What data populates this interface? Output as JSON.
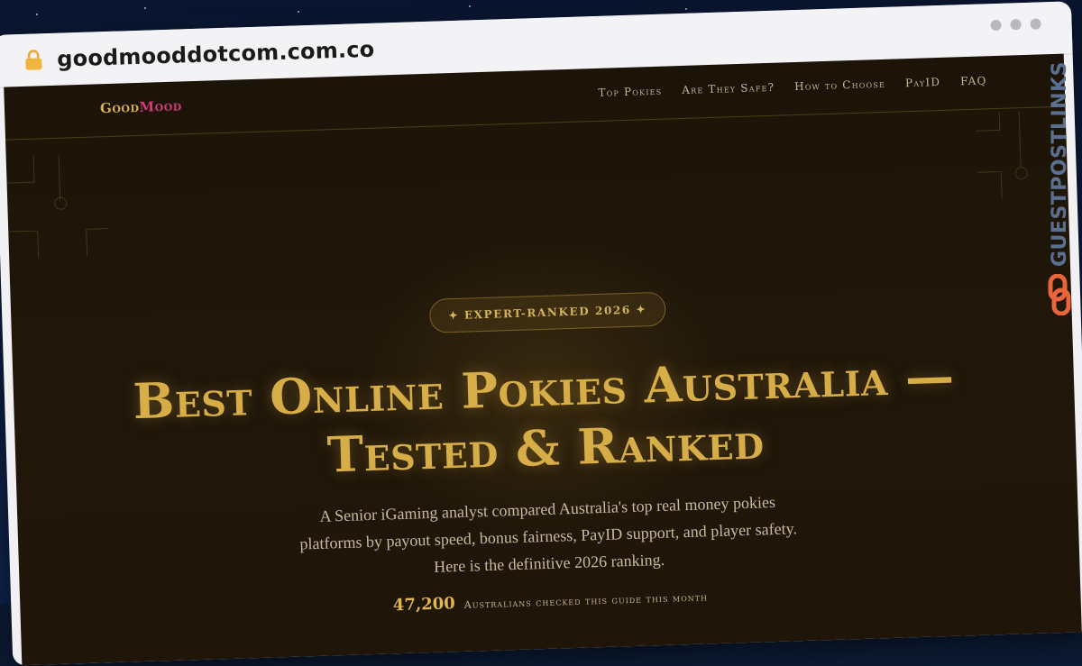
{
  "browser": {
    "url": "goodmooddotcom.com.co"
  },
  "site": {
    "logo_part1": "Good",
    "logo_part2": "Mood",
    "nav": [
      {
        "label": "Top Pokies"
      },
      {
        "label": "Are They Safe?"
      },
      {
        "label": "How to Choose"
      },
      {
        "label": "PayID"
      },
      {
        "label": "FAQ"
      }
    ]
  },
  "hero": {
    "badge": "✦ EXPERT-RANKED 2026 ✦",
    "title": "Best Online Pokies Australia — Tested & Ranked",
    "subtitle": "A Senior iGaming analyst compared Australia's top real money pokies platforms by payout speed, bonus fairness, PayID support, and player safety. Here is the definitive 2026 ranking.",
    "stat_value": "47,200",
    "stat_label": "Australians checked this guide this month"
  },
  "watermark": {
    "text": "GUESTPOSTLINKS"
  },
  "colors": {
    "gold": "#d6ad46",
    "brand_pink": "#d23b7a",
    "background": "#1e1509",
    "watermark_orange": "#e8663a"
  }
}
